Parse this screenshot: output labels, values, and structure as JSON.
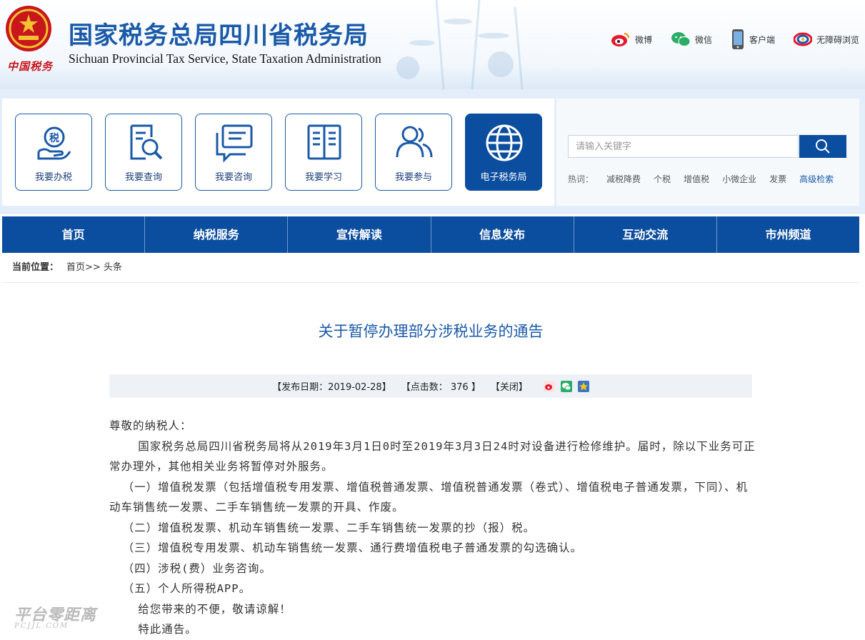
{
  "header": {
    "title": "国家税务总局四川省税务局",
    "subtitle": "Sichuan Provincial Tax Service, State Taxation Administration",
    "emblem_caption": "中国税务",
    "links": [
      {
        "label": "微博",
        "icon": "weibo-icon"
      },
      {
        "label": "微信",
        "icon": "wechat-icon"
      },
      {
        "label": "客户端",
        "icon": "mobile-icon"
      },
      {
        "label": "无障碍浏览",
        "icon": "accessibility-icon"
      }
    ]
  },
  "quick_links": [
    {
      "label": "我要办税",
      "icon": "tax-hand-icon"
    },
    {
      "label": "我要查询",
      "icon": "document-search-icon"
    },
    {
      "label": "我要咨询",
      "icon": "chat-icon"
    },
    {
      "label": "我要学习",
      "icon": "book-icon"
    },
    {
      "label": "我要参与",
      "icon": "people-icon"
    },
    {
      "label": "电子税务局",
      "icon": "globe-icon"
    }
  ],
  "search": {
    "placeholder": "请输入关键字",
    "hot_label": "热词：",
    "hot_words": [
      "减税降费",
      "个税",
      "增值税",
      "小微企业",
      "发票"
    ],
    "advanced": "高级检索"
  },
  "nav": [
    "首页",
    "纳税服务",
    "宣传解读",
    "信息发布",
    "互动交流",
    "市州频道"
  ],
  "breadcrumb": {
    "current_label": "当前位置：",
    "path": "首页>> 头条"
  },
  "article": {
    "title": "关于暂停办理部分涉税业务的通告",
    "meta_date": "【发布日期：2019-02-28】",
    "meta_clicks_label": "【点击数：",
    "meta_clicks_value": "376",
    "meta_clicks_end": "】",
    "meta_close": "【关闭】",
    "greeting": "尊敬的纳税人：",
    "paragraph1": "国家税务总局四川省税务局将从2019年3月1日0时至2019年3月3日24时对设备进行检修维护。届时，除以下业务可正常办理外，其他相关业务将暂停对外服务。",
    "item1": "（一）增值税发票（包括增值税专用发票、增值税普通发票、增值税普通发票（卷式）、增值税电子普通发票，下同）、机动车销售统一发票、二手车销售统一发票的开具、作废。",
    "item2": "（二）增值税发票、机动车销售统一发票、二手车销售统一发票的抄（报）税。",
    "item3": "（三）增值税专用发票、机动车销售统一发票、通行费增值税电子普通发票的勾选确认。",
    "item4": "（四）涉税(费）业务咨询。",
    "item5": "（五）个人所得税APP。",
    "apology": "给您带来的不便，敬请谅解！",
    "closing": "特此通告。"
  },
  "watermark": {
    "line1": "平台零距离",
    "line2": "PCJJL.COM"
  },
  "colors": {
    "brand_blue": "#0b4d9e",
    "title_blue": "#1a5aa8",
    "emblem_red": "#c8161d"
  }
}
